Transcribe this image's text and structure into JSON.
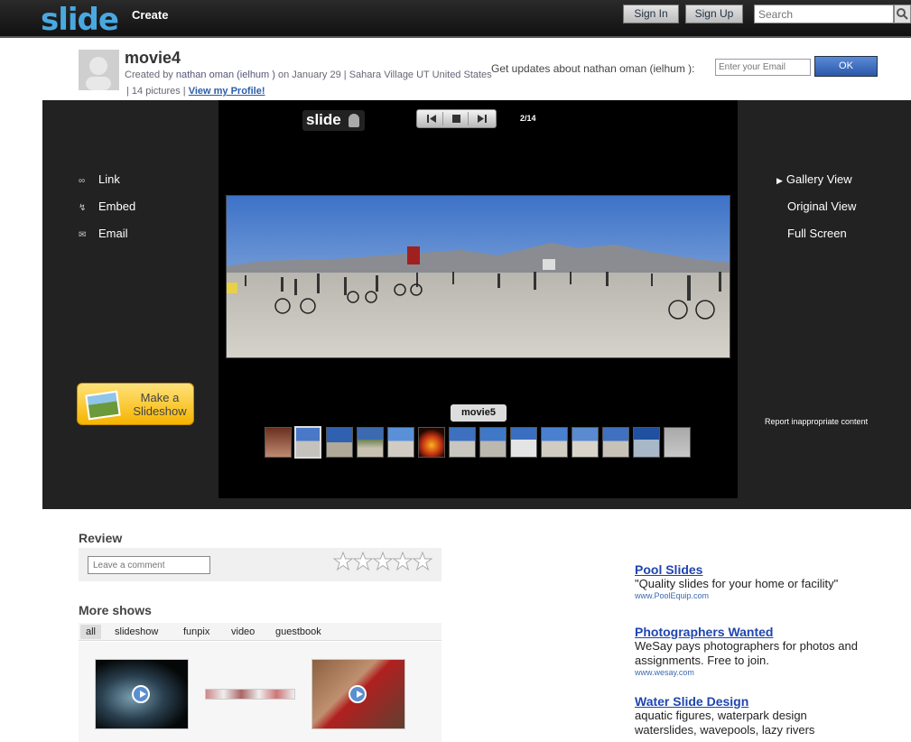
{
  "topbar": {
    "logo": "slide",
    "create_label": "Create",
    "signin_label": "Sign In",
    "signup_label": "Sign Up",
    "search_placeholder": "Search"
  },
  "header": {
    "title": "movie4",
    "created_by_prefix": "Created by",
    "author": "nathan oman (ielhum )",
    "date_text": "on January 29",
    "location": "Sahara Village UT United States",
    "pictures": "14 pictures",
    "profile_link": "View my Profile!",
    "updates_label": "Get updates about nathan oman (ielhum ):",
    "email_placeholder": "Enter your Email",
    "ok_label": "OK"
  },
  "player": {
    "badge": "slide",
    "counter": "2/14",
    "left_links": [
      {
        "icon": "link-icon",
        "label": "Link"
      },
      {
        "icon": "embed-icon",
        "label": "Embed"
      },
      {
        "icon": "email-icon",
        "label": "Email"
      }
    ],
    "right_links": [
      {
        "label": "Gallery View",
        "active": true
      },
      {
        "label": "Original View",
        "active": false
      },
      {
        "label": "Full Screen",
        "active": false
      }
    ],
    "make_slideshow": "Make a Slideshow",
    "thumb_label": "movie5",
    "report_link": "Report inappropriate content",
    "thumbnail_count": 14,
    "selected_thumbnail": 2
  },
  "review": {
    "title": "Review",
    "comment_placeholder": "Leave a comment",
    "star_count": 5
  },
  "more_shows": {
    "title": "More shows",
    "tabs": [
      "all",
      "slideshow",
      "funpix",
      "video",
      "guestbook"
    ],
    "active_tab": "all"
  },
  "ads": [
    {
      "title": "Pool Slides",
      "text": "\"Quality slides for your home or facility\"",
      "url": "www.PoolEquip.com"
    },
    {
      "title": "Photographers Wanted",
      "text": "WeSay pays photographers for photos and assignments. Free to join.",
      "url": "www.wesay.com"
    },
    {
      "title": "Water Slide Design",
      "text": "aquatic figures, waterpark design waterslides, wavepools, lazy rivers",
      "url": ""
    }
  ]
}
